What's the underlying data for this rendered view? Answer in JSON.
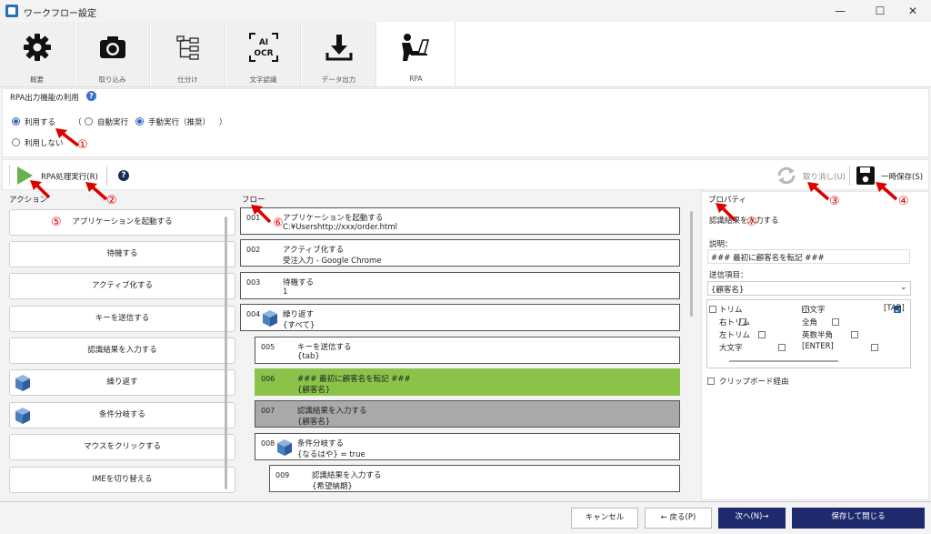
{
  "window": {
    "title": "ワークフロー設定",
    "minimize": "—",
    "maximize": "☐",
    "close": "✕"
  },
  "tabs": [
    {
      "label": "概要"
    },
    {
      "label": "取り込み"
    },
    {
      "label": "仕分け"
    },
    {
      "label": "文字認識"
    },
    {
      "label": "データ出力"
    },
    {
      "label": "RPA"
    }
  ],
  "ocr_icon": {
    "line1": "AI",
    "line2": "OCR"
  },
  "rpa_usage": {
    "title": "RPA出力機能の利用",
    "use": "利用する",
    "paren_open": "（",
    "auto": "自動実行",
    "manual": "手動実行（推奨）",
    "paren_close": "）",
    "not_use": "利用しない"
  },
  "toolbar": {
    "run": "RPA処理実行(R)",
    "cancel": "取り消し(U)",
    "save_temp": "一時保存(S)"
  },
  "actions": {
    "header": "アクション",
    "items": [
      {
        "label": "アプリケーションを起動する"
      },
      {
        "label": "待機する"
      },
      {
        "label": "アクティブ化する"
      },
      {
        "label": "キーを送信する"
      },
      {
        "label": "認識結果を入力する"
      },
      {
        "label": "繰り返す"
      },
      {
        "label": "条件分岐する"
      },
      {
        "label": "マウスをクリックする"
      },
      {
        "label": "IMEを切り替える"
      }
    ]
  },
  "flow": {
    "header": "フロー",
    "items": [
      {
        "num": "001",
        "title": "アプリケーションを起動する",
        "sub": "C:¥Usershttp://xxx/order.html"
      },
      {
        "num": "002",
        "title": "アクティブ化する",
        "sub": "受注入力 - Google Chrome"
      },
      {
        "num": "003",
        "title": "待機する",
        "sub": "1"
      },
      {
        "num": "004",
        "title": "繰り返す",
        "sub": "{すべて}"
      },
      {
        "num": "005",
        "title": "キーを送信する",
        "sub": "{tab}"
      },
      {
        "num": "006",
        "title": "### 最初に顧客名を転記 ###",
        "sub": "{顧客名}"
      },
      {
        "num": "007",
        "title": "認識結果を入力する",
        "sub": "{顧客名}"
      },
      {
        "num": "008",
        "title": "条件分岐する",
        "sub": "{なるはや} = true"
      },
      {
        "num": "009",
        "title": "認識結果を入力する",
        "sub": "{希望納期}"
      }
    ]
  },
  "properties": {
    "header": "プロパティ",
    "action_name": "認識結果を入力する",
    "desc_label": "説明：",
    "desc_value": "### 最初に顧客名を転記 ###",
    "send_label": "送信項目：",
    "send_value": "{顧客名}",
    "options": [
      {
        "label": "トリム",
        "checked": false
      },
      {
        "label": "小文字",
        "checked": false
      },
      {
        "label": "[TAB]",
        "checked": true
      },
      {
        "label": "右トリム",
        "checked": false
      },
      {
        "label": "全角",
        "checked": false
      },
      {
        "label": "左トリム",
        "checked": false
      },
      {
        "label": "英数半角",
        "checked": false
      },
      {
        "label": "大文字",
        "checked": false
      },
      {
        "label": "[ENTER]",
        "checked": false
      }
    ],
    "clipboard": "クリップボード経由"
  },
  "annotations": [
    "①",
    "②",
    "③",
    "④",
    "⑤",
    "⑥",
    "⑦"
  ],
  "footer": {
    "cancel": "キャンセル",
    "back": "← 戻る(P)",
    "next": "次へ(N)→",
    "save_close": "保存して閉じる"
  },
  "colors": {
    "accent": "#2764b8",
    "selected_flow": "#8bc34a",
    "active_flow": "#a9a9a9",
    "annotation": "#d00000",
    "primary_button": "#1f2a6e"
  }
}
